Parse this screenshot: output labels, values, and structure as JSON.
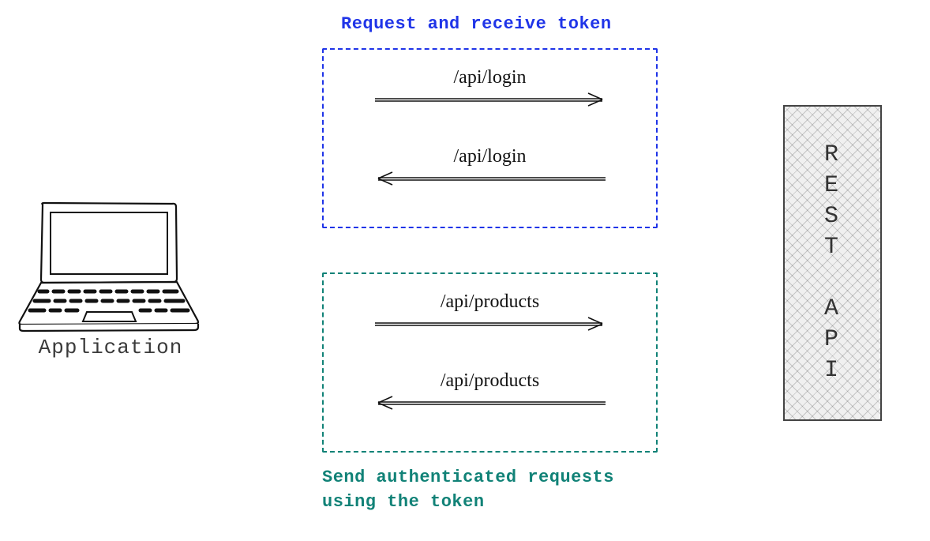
{
  "left": {
    "label": "Application",
    "icon": "laptop-icon"
  },
  "box_top": {
    "title": "Request and receive token",
    "req_endpoint": "/api/login",
    "res_endpoint": "/api/login",
    "color": "#1f34e8"
  },
  "box_bottom": {
    "title": "Send authenticated requests using the token",
    "req_endpoint": "/api/products",
    "res_endpoint": "/api/products",
    "color": "#118277"
  },
  "right": {
    "label": "R\nE\nS\nT\n\nA\nP\nI"
  }
}
